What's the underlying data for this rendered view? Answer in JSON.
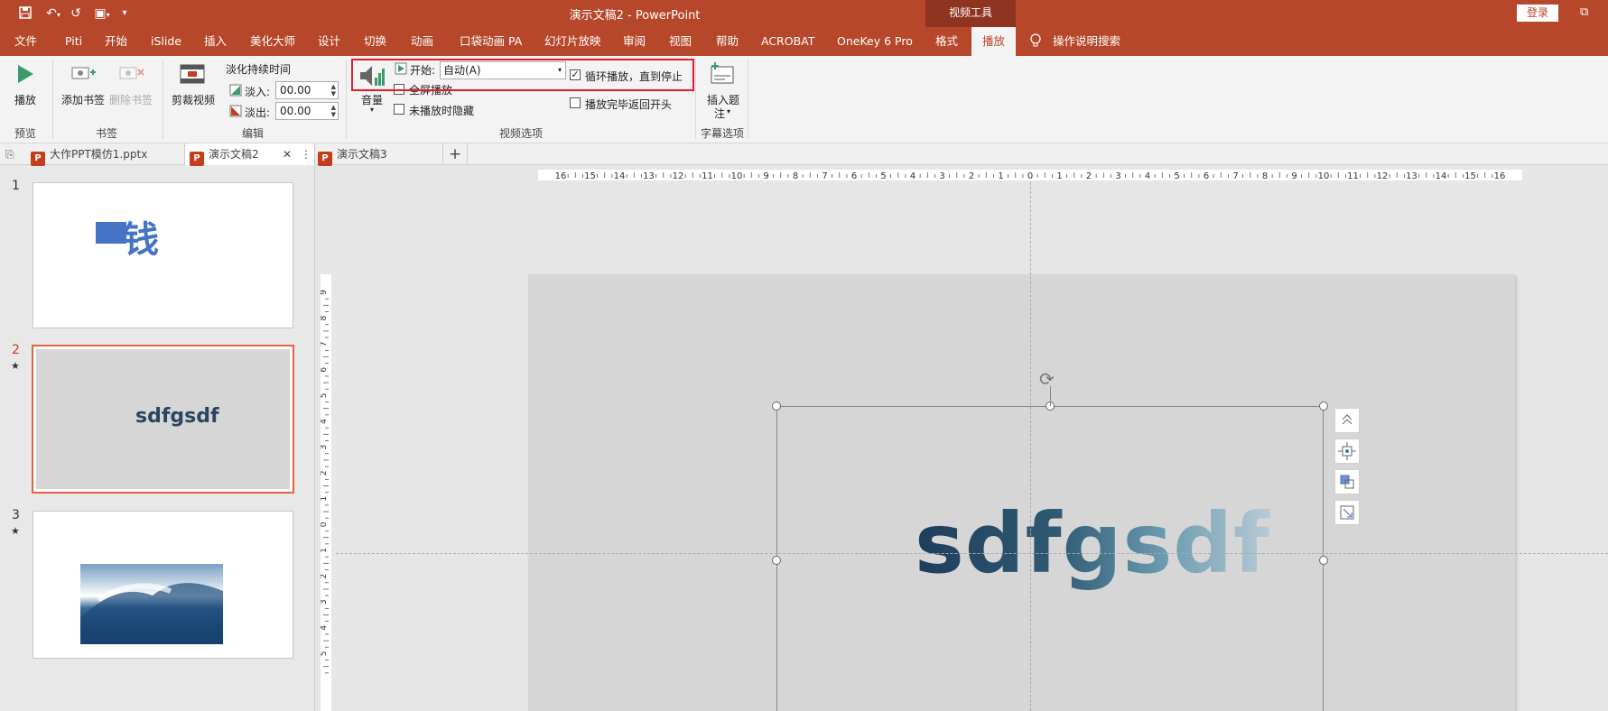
{
  "title_bar": {
    "title": "演示文稿2  -  PowerPoint",
    "context_tab": "视频工具",
    "login": "登录",
    "quick_access": [
      "save-icon",
      "undo-icon",
      "redo-icon",
      "present-icon",
      "customize-icon"
    ]
  },
  "menu": {
    "items": [
      "文件",
      "Piti",
      "开始",
      "iSlide",
      "插入",
      "美化大师",
      "设计",
      "切换",
      "动画",
      "口袋动画 PA",
      "幻灯片放映",
      "审阅",
      "视图",
      "帮助",
      "ACROBAT",
      "OneKey 6 Pro",
      "格式",
      "播放"
    ],
    "active": "播放",
    "search": "操作说明搜索"
  },
  "ribbon": {
    "play": "播放",
    "add_bookmark": "添加书签",
    "remove_bookmark": "删除书签",
    "trim_video": "剪裁视频",
    "fade_duration": "淡化持续时间",
    "fade_in_label": "淡入:",
    "fade_in_value": "00.00",
    "fade_out_label": "淡出:",
    "fade_out_value": "00.00",
    "volume": "音量",
    "start_label": "开始:",
    "start_value": "自动(A)",
    "fullscreen": "全屏播放",
    "hide_not_playing": "未播放时隐藏",
    "loop": "循环播放，直到停止",
    "rewind": "播放完毕返回开头",
    "insert_caption_1": "插入题",
    "insert_caption_2": "注",
    "groups": {
      "preview": "预览",
      "bookmarks": "书签",
      "editing": "编辑",
      "video_options": "视频选项",
      "caption_options": "字幕选项"
    },
    "checkbox_state": {
      "fullscreen": false,
      "hide": false,
      "loop": true,
      "rewind": false
    }
  },
  "tabs": [
    {
      "label": "大作PPT模仿1.pptx",
      "active": false
    },
    {
      "label": "演示文稿2",
      "active": true
    },
    {
      "label": "演示文稿3",
      "active": false
    }
  ],
  "thumbnails": [
    {
      "num": "1",
      "star": "",
      "text": "钱"
    },
    {
      "num": "2",
      "star": "★",
      "text": "sdfgsdf"
    },
    {
      "num": "3",
      "star": "★",
      "text": ""
    }
  ],
  "ruler": {
    "h_labels": [
      "16",
      "15",
      "14",
      "13",
      "12",
      "11",
      "10",
      "9",
      "8",
      "7",
      "6",
      "5",
      "4",
      "3",
      "2",
      "1",
      "0",
      "1",
      "2",
      "3",
      "4",
      "5",
      "6",
      "7",
      "8",
      "9",
      "10",
      "11",
      "12",
      "13",
      "14",
      "15",
      "16"
    ],
    "v_labels": [
      "9",
      "8",
      "7",
      "6",
      "5",
      "4",
      "3",
      "2",
      "1",
      "0",
      "1",
      "2",
      "3",
      "4",
      "5"
    ]
  },
  "slide": {
    "text": "sdfgsdf"
  },
  "colors": {
    "accent": "#b7472a",
    "highlight": "#e21b2d"
  }
}
